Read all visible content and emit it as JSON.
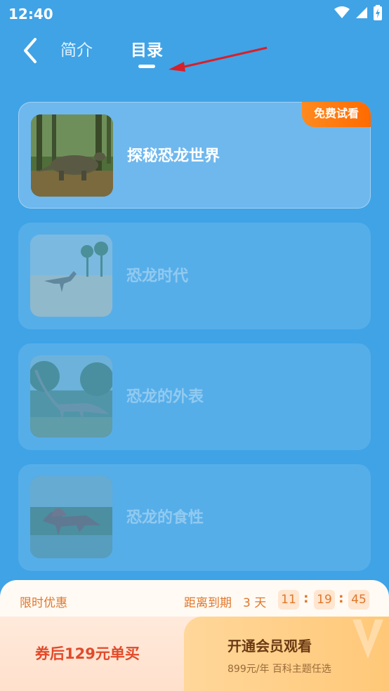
{
  "status_bar": {
    "time": "12:40"
  },
  "header": {
    "tabs": [
      {
        "label": "简介",
        "active": false
      },
      {
        "label": "目录",
        "active": true
      }
    ]
  },
  "catalog": {
    "items": [
      {
        "title": "探秘恐龙世界",
        "badge": "免费试看",
        "locked": false,
        "thumbnail": "ankylosaurus-in-forest"
      },
      {
        "title": "恐龙时代",
        "locked": true,
        "thumbnail": "theropod-on-beach"
      },
      {
        "title": "恐龙的外表",
        "locked": true,
        "thumbnail": "sauropod-in-forest"
      },
      {
        "title": "恐龙的食性",
        "locked": true,
        "thumbnail": "spinosaurus-by-river"
      }
    ]
  },
  "promo": {
    "label": "限时优惠",
    "countdown_label": "距离到期",
    "countdown_days": "3 天",
    "countdown": {
      "hours": "11",
      "minutes": "19",
      "seconds": "45",
      "separator": ":"
    }
  },
  "purchase": {
    "single_label": "券后129元单买",
    "vip_title": "开通会员观看",
    "vip_subtitle": "899元/年 百科主题任选"
  },
  "colors": {
    "background": "#3fa3e6",
    "badge": "#ff7a10",
    "promo_text": "#e0772a",
    "single_buy_text": "#e24a2a",
    "vip_bg": "#ffc878"
  }
}
